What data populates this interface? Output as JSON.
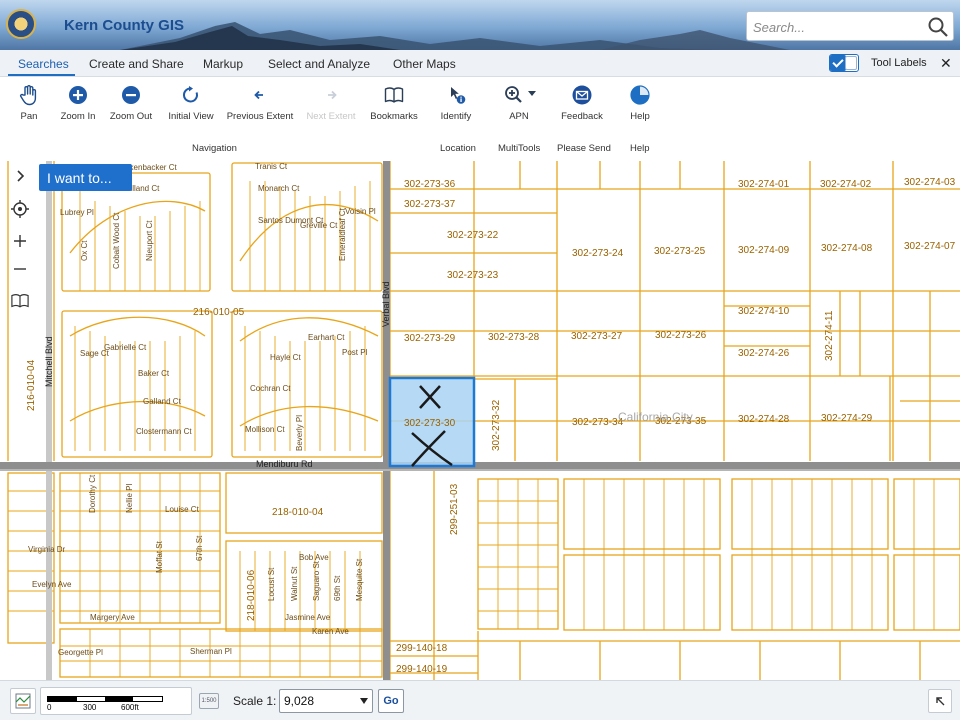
{
  "app": {
    "title": "Kern County GIS"
  },
  "search": {
    "placeholder": "Search..."
  },
  "tabs": [
    "Searches",
    "Create and Share",
    "Markup",
    "Select and Analyze",
    "Other Maps"
  ],
  "tool_labels": {
    "label": "Tool Labels",
    "checked": true
  },
  "toolbar": {
    "tools": [
      {
        "label": "Pan",
        "icon": "hand-icon"
      },
      {
        "label": "Zoom In",
        "icon": "zoom-in-icon"
      },
      {
        "label": "Zoom Out",
        "icon": "zoom-out-icon"
      },
      {
        "label": "Initial View",
        "icon": "initial-view-icon"
      },
      {
        "label": "Previous Extent",
        "icon": "previous-extent-icon"
      },
      {
        "label": "Next Extent",
        "icon": "next-extent-icon",
        "disabled": true
      },
      {
        "label": "Bookmarks",
        "icon": "book-icon"
      },
      {
        "label": "Identify",
        "icon": "identify-icon"
      },
      {
        "label": "APN",
        "icon": "magnifier-dropdown-icon"
      },
      {
        "label": "Feedback",
        "icon": "mail-icon"
      },
      {
        "label": "Help",
        "icon": "help-icon"
      }
    ],
    "groups": [
      "Navigation",
      "Location",
      "MultiTools",
      "Please Send",
      "Help"
    ]
  },
  "map": {
    "i_want_to": "I want to...",
    "selected_parcel": "302-273-30",
    "parcels": [
      "302-273-36",
      "302-273-37",
      "302-274-01",
      "302-274-02",
      "302-274-03",
      "302-273-22",
      "302-273-24",
      "302-273-25",
      "302-274-09",
      "302-274-08",
      "302-274-07",
      "302-273-23",
      "302-274-10",
      "302-274-11",
      "302-273-29",
      "302-273-28",
      "302-273-27",
      "302-273-26",
      "302-274-26",
      "302-273-32",
      "302-273-30",
      "302-273-34",
      "302-273-35",
      "302-274-28",
      "302-274-29",
      "216-010-05",
      "216-010-04",
      "218-010-04",
      "218-010-06",
      "299-251-03",
      "299-140-18",
      "299-140-19"
    ],
    "roads": [
      "Mitchell Blvd",
      "Verbal Blvd",
      "Mendiburu Rd",
      "Rickenbacker Ct",
      "Tranis Ct",
      "Delavilland Ct",
      "Monarch Ct",
      "Lubrey Pl",
      "Voisin Pl",
      "Santos Dumont Ct",
      "Greville Ct",
      "Ox Ct",
      "Nieuport Ct",
      "Cobalt Wood Ct",
      "Emeraldleaf Ct",
      "Sage Ct",
      "Baker Ct",
      "Gabrielle Ct",
      "Hayle Ct",
      "Cochran Ct",
      "Earhart Ct",
      "Post Pl",
      "Galland Ct",
      "Clostermann Ct",
      "Mollison Ct",
      "Beverly Pl",
      "Dorothy Ct",
      "Nellie Pl",
      "Louise Ct",
      "Virginia Dr",
      "Evelyn Ave",
      "Moffat St",
      "67th St",
      "Bob Ave",
      "Locust St",
      "Walnut St",
      "Saguaro St",
      "69th St",
      "Mesquite St",
      "Jasmine Ave",
      "Margery Ave",
      "Karen Ave",
      "Georgette Pl",
      "Sherman Pl"
    ],
    "overlay_text": "California City"
  },
  "footer": {
    "scale_ticks": [
      "0",
      "300",
      "600ft"
    ],
    "scale_icon_text": "1:500",
    "scale_label": "Scale 1:",
    "scale_value": "9,028",
    "go_label": "Go"
  }
}
